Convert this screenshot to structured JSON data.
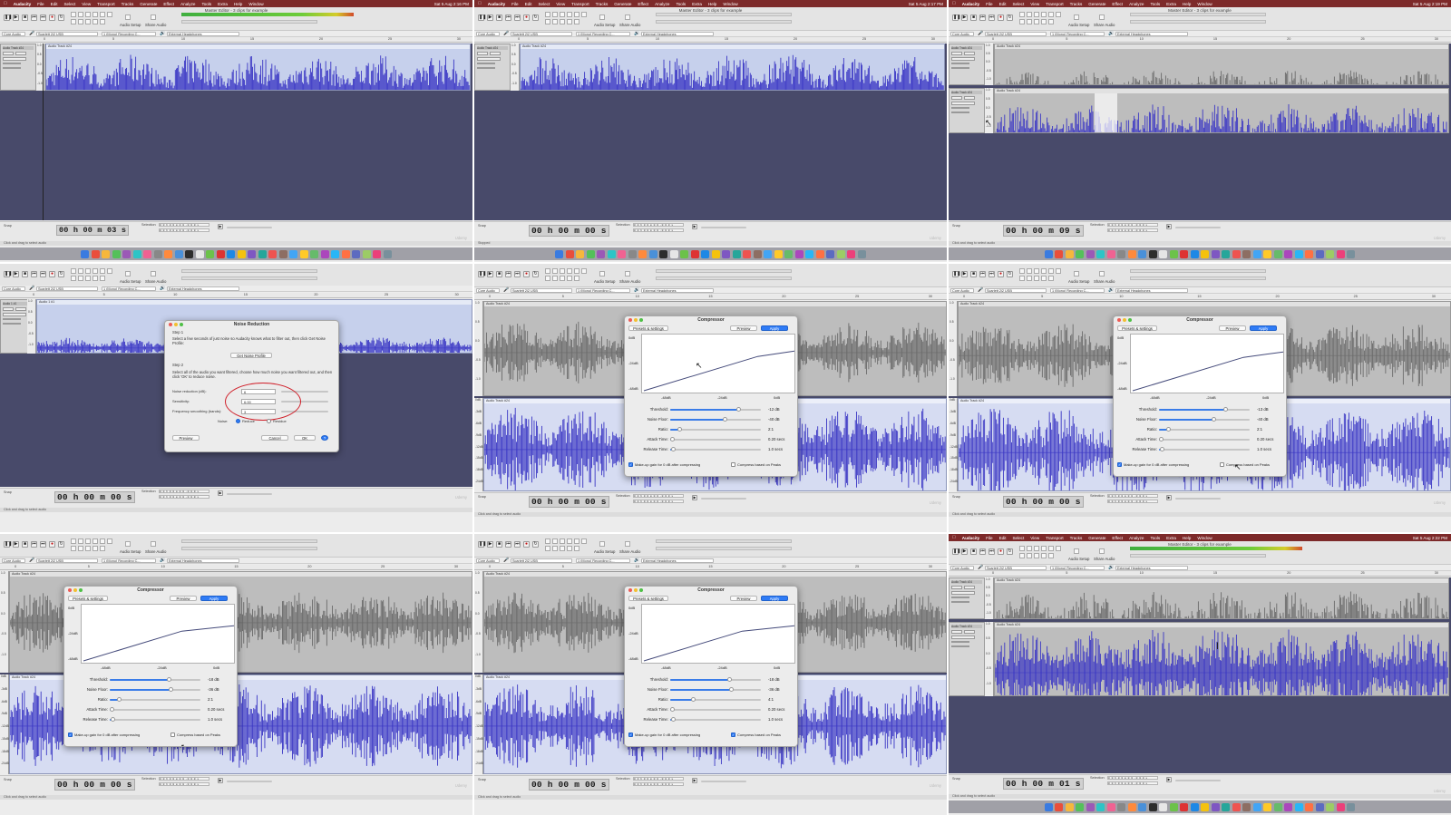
{
  "menu": {
    "apple": "",
    "app": "Audacity",
    "items": [
      "File",
      "Edit",
      "Select",
      "View",
      "Transport",
      "Tracks",
      "Generate",
      "Effect",
      "Analyze",
      "Tools",
      "Extra",
      "Help",
      "Window"
    ]
  },
  "window_title": "Master Editor - 3 clips for example",
  "toolbar": {
    "audio_setup": "Audio Setup",
    "share_audio": "Share Audio"
  },
  "devices": {
    "host": "Core Audio",
    "input": "Scarlett 2i2 USB",
    "channels": "1 (Mono) Recording C...",
    "output": "External Headphones"
  },
  "track_names": {
    "track24": "Audio Track #24",
    "track1": "Audio 1 #1"
  },
  "bottom": {
    "snap": "Snap",
    "selection": "Selection",
    "selection_value": "0 0 h 0 0 m 0 0 .0 0 0 s",
    "playing": "Playing",
    "stopped": "Stopped",
    "hint": "Click and drag to select audio"
  },
  "panels": [
    {
      "clock": "Sat 5 Aug 2:16 PM",
      "time": "00 h 00 m 03 s"
    },
    {
      "clock": "Sat 5 Aug 2:17 PM",
      "time": "00 h 00 m 00 s"
    },
    {
      "clock": "Sat 5 Aug 2:19 PM",
      "time": "00 h 00 m 09 s"
    },
    {
      "time": "00 h 00 m 00 s"
    },
    {
      "time": "00 h 00 m 00 s"
    },
    {
      "time": "00 h 00 m 00 s"
    },
    {
      "time": "00 h 00 m 00 s"
    },
    {
      "time": "00 h 00 m 00 s"
    },
    {
      "clock": "Sat 5 Aug 2:22 PM",
      "time": "00 h 00 m 01 s"
    }
  ],
  "noise_reduction": {
    "title": "Noise Reduction",
    "step1_label": "Step 1",
    "step1_text": "Select a few seconds of just noise so Audacity knows what to filter out, then click Get Noise Profile:",
    "get_profile": "Get Noise Profile",
    "step2_label": "Step 2",
    "step2_text": "Select all of the audio you want filtered, choose how much noise you want filtered out, and then click 'OK' to reduce noise.",
    "noise_reduction_label": "Noise reduction (dB):",
    "noise_reduction_value": "6",
    "sensitivity_label": "Sensitivity:",
    "sensitivity_value": "6.00",
    "smoothing_label": "Frequency smoothing (bands):",
    "smoothing_value": "3",
    "noise_label": "Noise:",
    "reduce": "Reduce",
    "residue": "Residue",
    "preview": "Preview",
    "cancel": "Cancel",
    "ok": "OK",
    "help": "?"
  },
  "compressor": {
    "title": "Compressor",
    "presets": "Presets & settings",
    "preview": "Preview",
    "apply": "Apply",
    "graph_y": [
      "0dB",
      "-24dB",
      "-48dB"
    ],
    "graph_x": [
      "-48dB",
      "-24dB",
      "0dB"
    ],
    "labels": {
      "threshold": "Threshold:",
      "noise_floor": "Noise Floor:",
      "ratio": "Ratio:",
      "attack": "Attack Time:",
      "release": "Release Time:"
    },
    "makeup": "Make-up gain for 0 dB after compressing",
    "peaks": "Compress based on Peaks",
    "instances": [
      {
        "threshold": "-12 dB",
        "threshold_level": 0.75,
        "noise_floor": "-40 dB",
        "noise_floor_level": 0.6,
        "ratio": "2:1",
        "ratio_level": 0.1,
        "attack": "0.20 secs",
        "attack_level": 0.02,
        "release": "1.0 secs",
        "release_level": 0.03,
        "makeup": true,
        "peaks": false
      },
      {
        "threshold": "-13 dB",
        "threshold_level": 0.73,
        "noise_floor": "-40 dB",
        "noise_floor_level": 0.6,
        "ratio": "2:1",
        "ratio_level": 0.1,
        "attack": "0.20 secs",
        "attack_level": 0.02,
        "release": "1.0 secs",
        "release_level": 0.03,
        "makeup": true,
        "peaks": false
      },
      {
        "threshold": "-18 dB",
        "threshold_level": 0.65,
        "noise_floor": "-36 dB",
        "noise_floor_level": 0.67,
        "ratio": "2:1",
        "ratio_level": 0.1,
        "attack": "0.20 secs",
        "attack_level": 0.02,
        "release": "1.0 secs",
        "release_level": 0.03,
        "makeup": true,
        "peaks": false
      },
      {
        "threshold": "-18 dB",
        "threshold_level": 0.65,
        "noise_floor": "-36 dB",
        "noise_floor_level": 0.67,
        "ratio": "4:1",
        "ratio_level": 0.25,
        "attack": "0.20 secs",
        "attack_level": 0.02,
        "release": "1.0 secs",
        "release_level": 0.03,
        "makeup": true,
        "peaks": true
      }
    ]
  },
  "scale_labels": [
    "1.0",
    "0.5",
    "0.0",
    "-0.5",
    "-1.0"
  ],
  "db_scale_labels": [
    "0dB",
    "-3dB",
    "-6dB",
    "-9dB",
    "-12dB",
    "-15dB",
    "-18dB",
    "-24dB"
  ],
  "ruler_labels": [
    "0",
    "5",
    "10",
    "15",
    "20",
    "25",
    "30"
  ],
  "watermark": "Udemy",
  "colors": {
    "menubar": "#7d2a2a",
    "wave_blue": "#3a36c4",
    "wave_grey": "#6b6b6b",
    "track_bg": "#484a6a",
    "selection_blue": "#c6d0ec",
    "accent": "#2e7bf6",
    "annotation_red": "#d0202a"
  }
}
